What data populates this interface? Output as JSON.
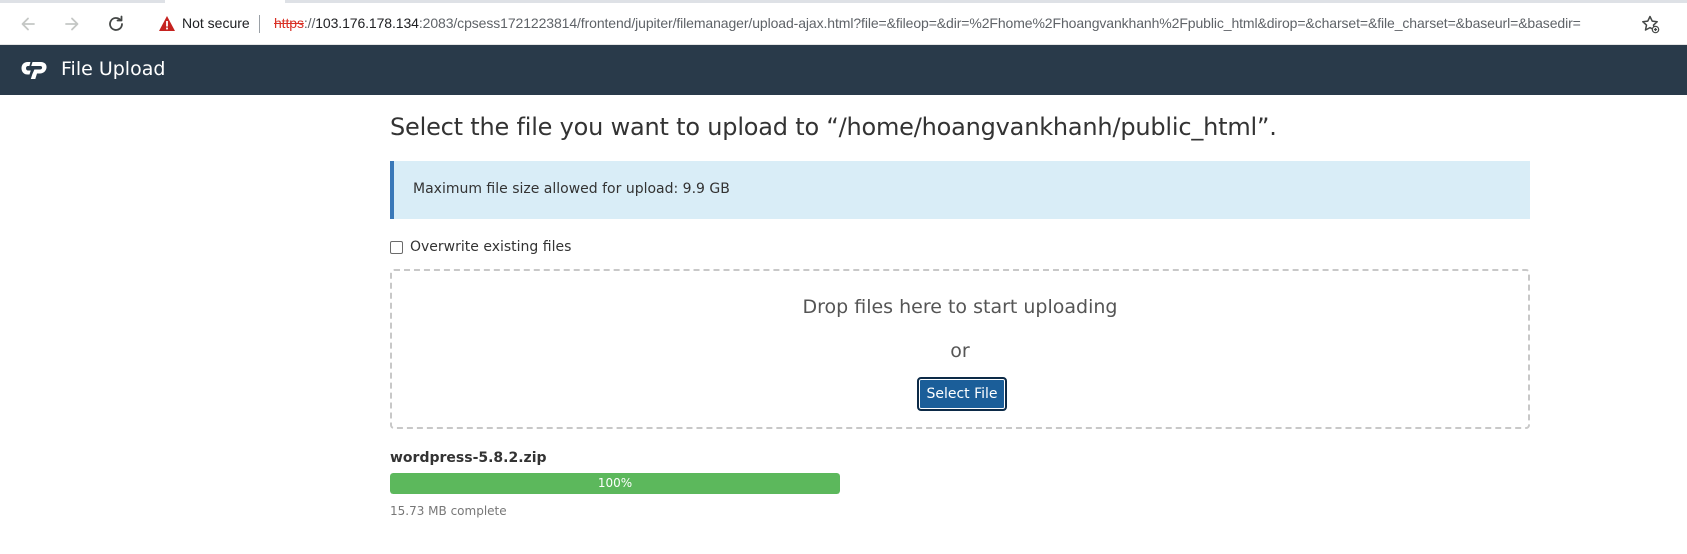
{
  "browser": {
    "security_label": "Not secure",
    "url": {
      "scheme": "https",
      "separator": "://",
      "host": "103.176.178.134",
      "rest": ":2083/cpsess1721223814/frontend/jupiter/filemanager/upload-ajax.html?file=&fileop=&dir=%2Fhome%2Fhoangvankhanh%2Fpublic_html&dirop=&charset=&file_charset=&baseurl=&basedir="
    }
  },
  "header": {
    "title": "File Upload"
  },
  "main": {
    "heading": "Select the file you want to upload to “/home/hoangvankhanh/public_html”.",
    "max_size_notice": "Maximum file size allowed for upload: 9.9 GB",
    "overwrite_label": "Overwrite existing files",
    "overwrite_checked": false,
    "drop_text": "Drop files here to start uploading",
    "or_text": "or",
    "select_button_label": "Select File"
  },
  "upload": {
    "file_name": "wordpress-5.8.2.zip",
    "progress_percent": 100,
    "progress_label": "100%",
    "status": "15.73 MB complete"
  },
  "colors": {
    "header_bg": "#293a4a",
    "alert_bg": "#d9edf7",
    "alert_border": "#3a78b8",
    "button_bg": "#1b5e99",
    "progress_fill": "#5cb85c",
    "insecure_red": "#d93025"
  }
}
